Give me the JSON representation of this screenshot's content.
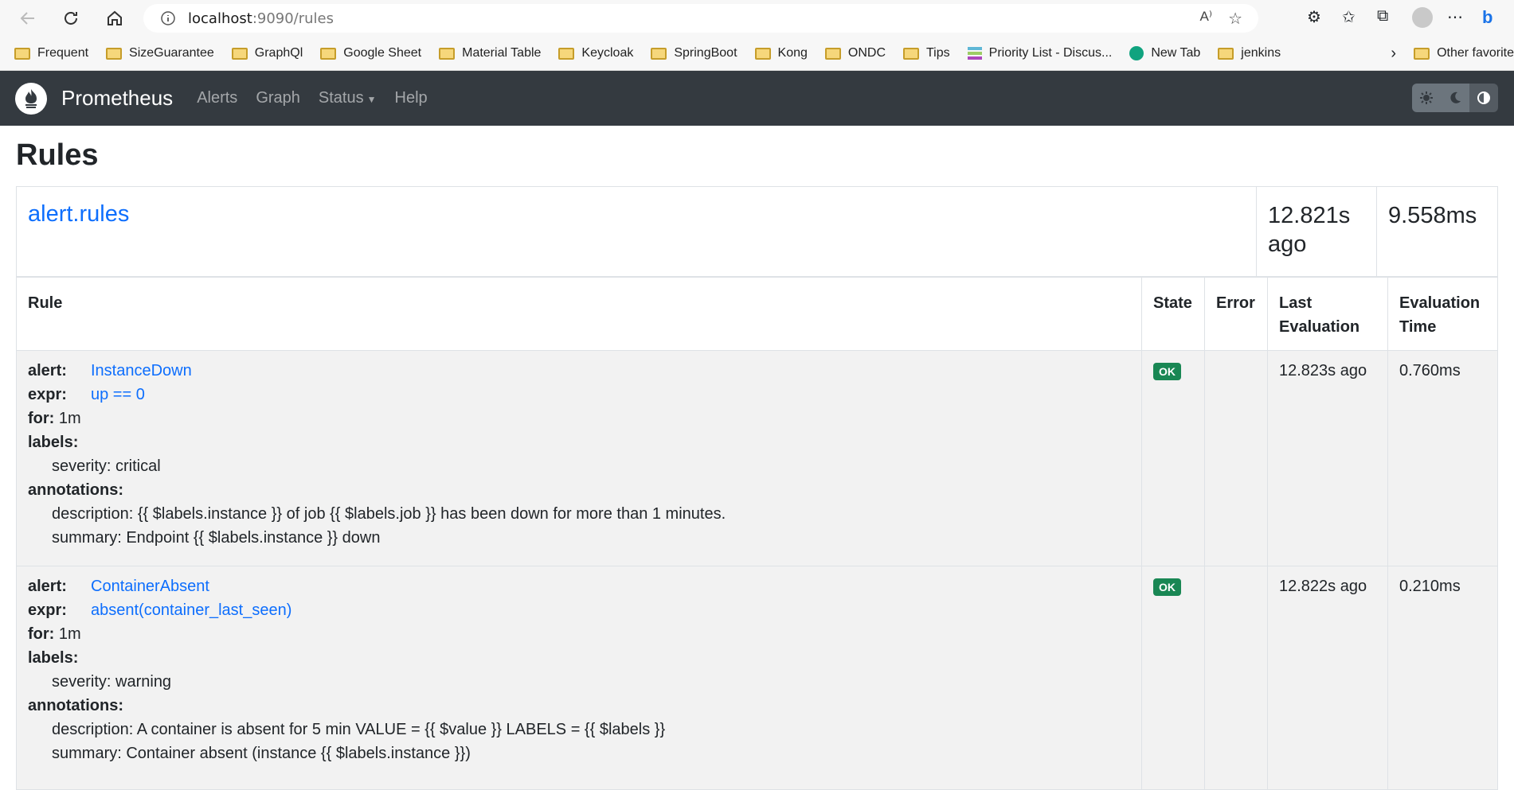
{
  "browser": {
    "url_host": "localhost",
    "url_path": ":9090/rules",
    "bookmarks": [
      "Frequent",
      "SizeGuarantee",
      "GraphQl",
      "Google Sheet",
      "Material Table",
      "Keycloak",
      "SpringBoot",
      "Kong",
      "ONDC",
      "Tips",
      "Priority List - Discus...",
      "New Tab",
      "jenkins"
    ],
    "other_favorites": "Other favorite"
  },
  "nav": {
    "brand": "Prometheus",
    "links": [
      "Alerts",
      "Graph",
      "Status",
      "Help"
    ]
  },
  "page": {
    "title": "Rules",
    "group": {
      "name": "alert.rules",
      "last_eval": "12.821s ago",
      "eval_time": "9.558ms"
    },
    "headers": {
      "rule": "Rule",
      "state": "State",
      "error": "Error",
      "last_eval": "Last Evaluation",
      "eval_time": "Evaluation Time"
    },
    "labels": {
      "alert": "alert:",
      "expr": "expr:",
      "for": "for:",
      "labels": "labels:",
      "annotations": "annotations:"
    },
    "rules": [
      {
        "alert": "InstanceDown",
        "expr": "up == 0",
        "for": "1m",
        "label_line": "severity: critical",
        "description": "description: {{ $labels.instance }} of job {{ $labels.job }} has been down for more than 1 minutes.",
        "summary": "summary: Endpoint {{ $labels.instance }} down",
        "state": "OK",
        "error": "",
        "last_eval": "12.823s ago",
        "eval_time": "0.760ms"
      },
      {
        "alert": "ContainerAbsent",
        "expr": "absent(container_last_seen)",
        "for": "1m",
        "label_line": "severity: warning",
        "description": "description: A container is absent for 5 min VALUE = {{ $value }} LABELS = {{ $labels }}",
        "summary": "summary: Container absent (instance {{ $labels.instance }})",
        "state": "OK",
        "error": "",
        "last_eval": "12.822s ago",
        "eval_time": "0.210ms"
      }
    ]
  }
}
